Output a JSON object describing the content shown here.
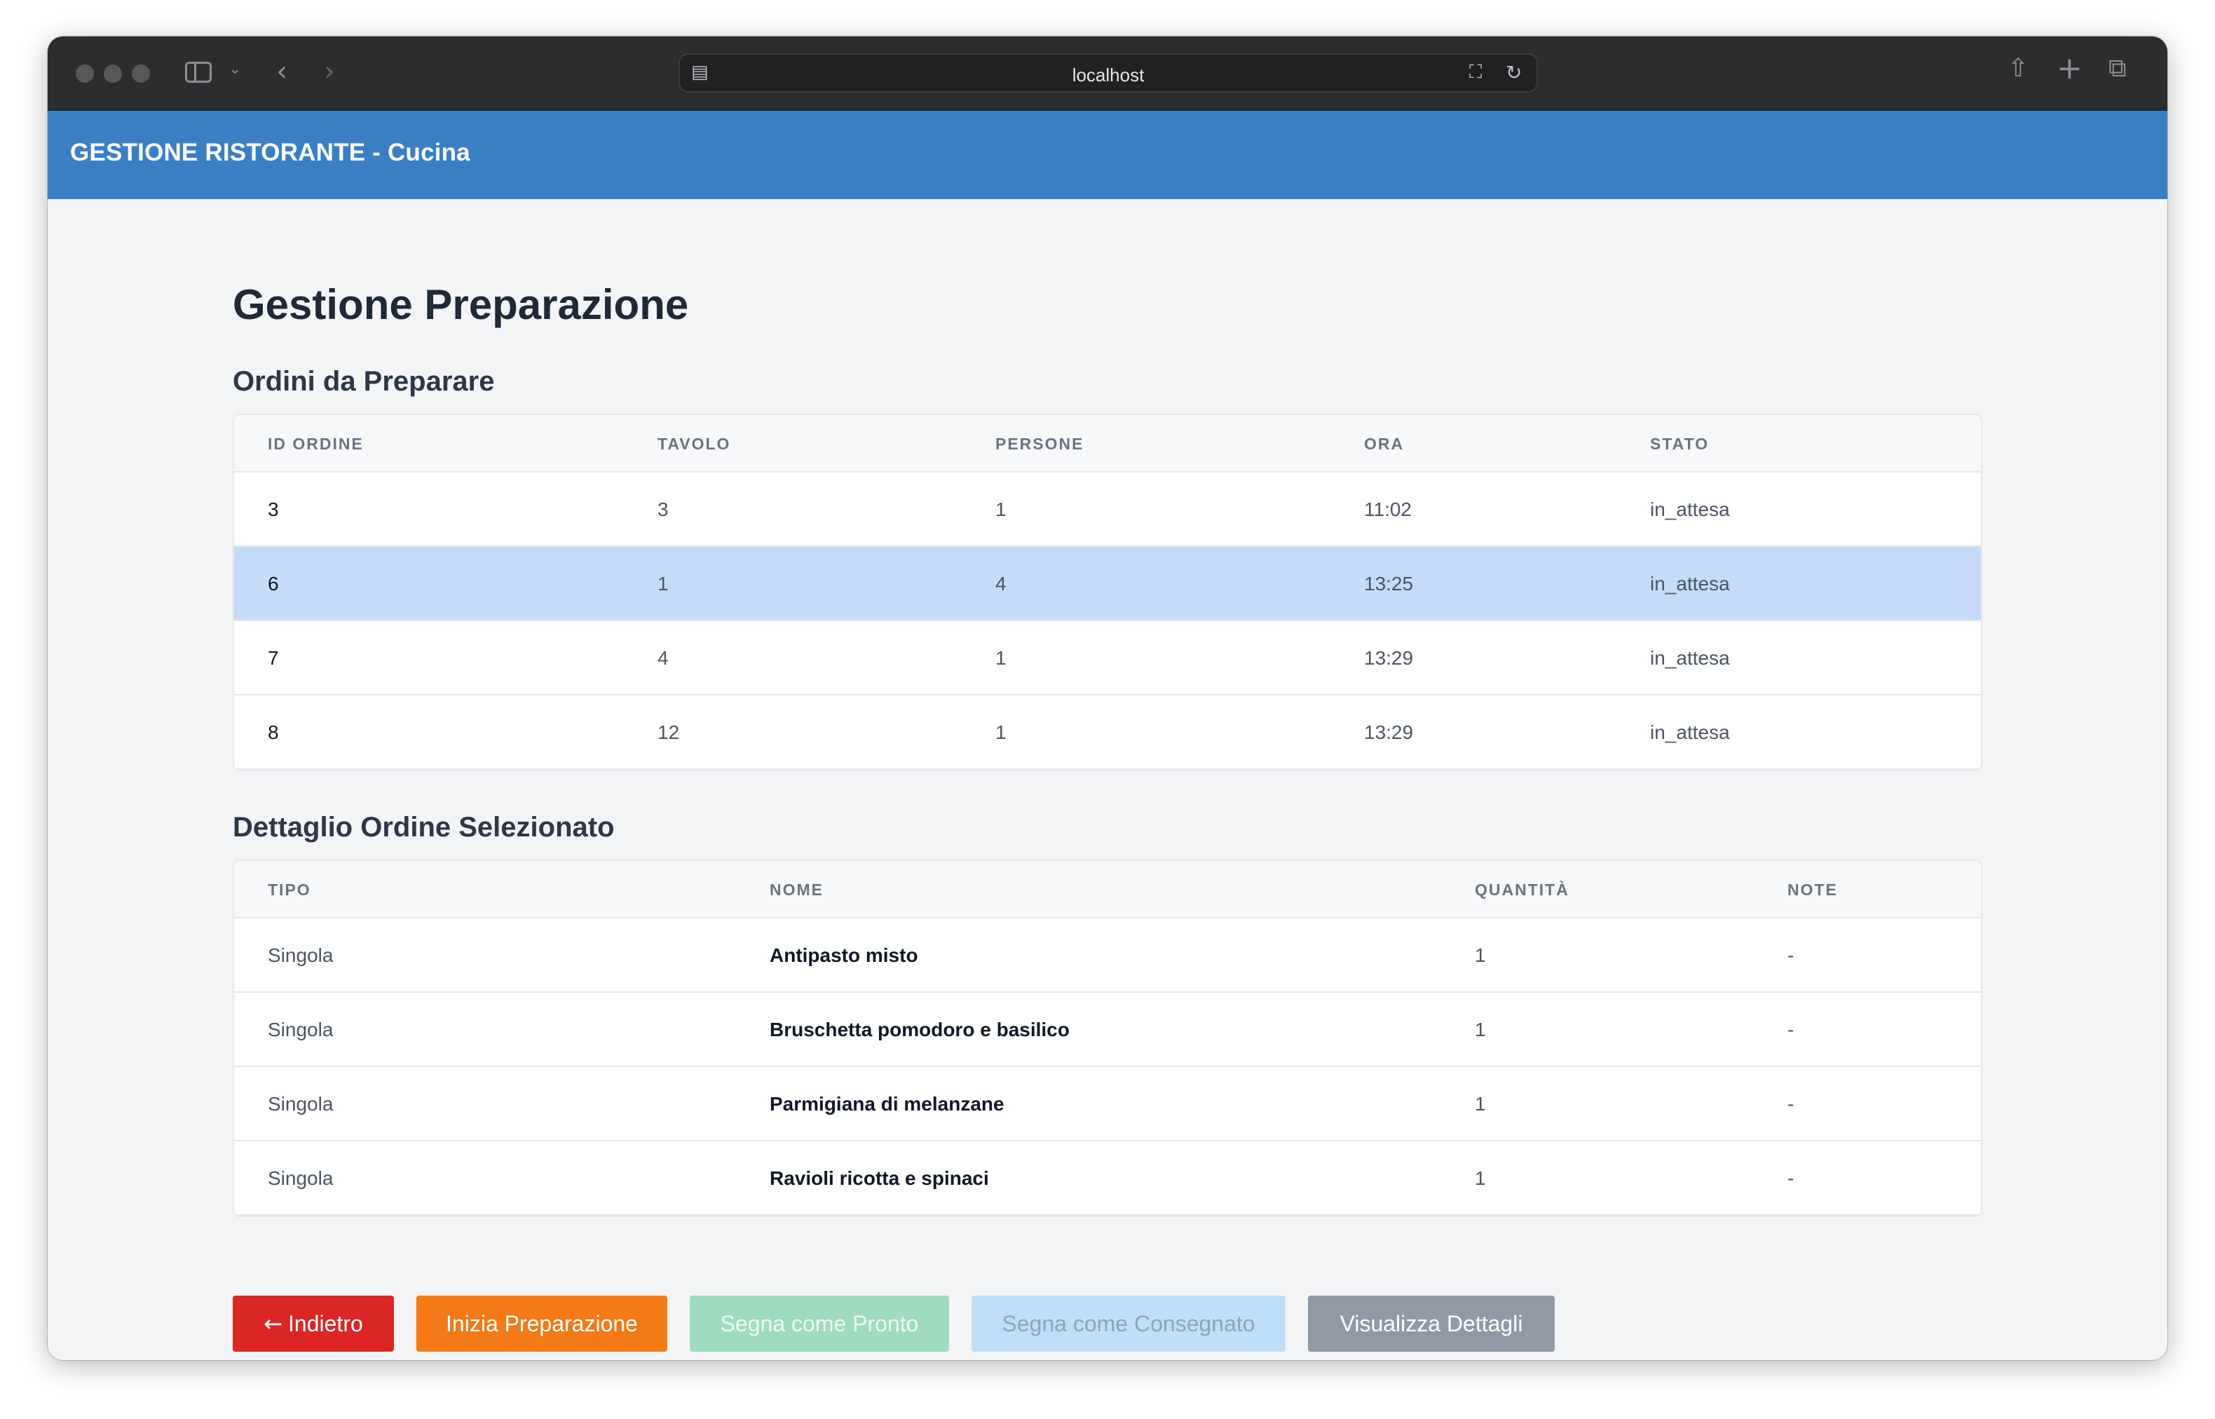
{
  "browser": {
    "url": "localhost"
  },
  "app": {
    "title": "GESTIONE RISTORANTE - Cucina",
    "header_color": "#3a7fc4"
  },
  "page": {
    "title": "Gestione Preparazione"
  },
  "orders": {
    "section_title": "Ordini da Preparare",
    "columns": [
      "ID ORDINE",
      "TAVOLO",
      "PERSONE",
      "ORA",
      "STATO"
    ],
    "selected_index": 1,
    "rows": [
      {
        "id": "3",
        "table": "3",
        "people": "1",
        "time": "11:02",
        "status": "in_attesa"
      },
      {
        "id": "6",
        "table": "1",
        "people": "4",
        "time": "13:25",
        "status": "in_attesa"
      },
      {
        "id": "7",
        "table": "4",
        "people": "1",
        "time": "13:29",
        "status": "in_attesa"
      },
      {
        "id": "8",
        "table": "12",
        "people": "1",
        "time": "13:29",
        "status": "in_attesa"
      }
    ]
  },
  "details": {
    "section_title": "Dettaglio Ordine Selezionato",
    "columns": [
      "TIPO",
      "NOME",
      "QUANTITÀ",
      "NOTE"
    ],
    "rows": [
      {
        "type": "Singola",
        "name": "Antipasto misto",
        "qty": "1",
        "note": "-"
      },
      {
        "type": "Singola",
        "name": "Bruschetta pomodoro e basilico",
        "qty": "1",
        "note": "-"
      },
      {
        "type": "Singola",
        "name": "Parmigiana di melanzane",
        "qty": "1",
        "note": "-"
      },
      {
        "type": "Singola",
        "name": "Ravioli ricotta e spinaci",
        "qty": "1",
        "note": "-"
      }
    ]
  },
  "actions": {
    "back_arrow": "←",
    "back_label": "Indietro",
    "start_label": "Inizia Preparazione",
    "ready_label": "Segna come Pronto",
    "delivered_label": "Segna come Consegnato",
    "details_label": "Visualizza Dettagli",
    "colors": {
      "back": "#dc2626",
      "start": "#f47a17",
      "ready_disabled": "#9fdbbe",
      "delivered_disabled": "#bfdff9",
      "details": "#9199a6"
    }
  }
}
